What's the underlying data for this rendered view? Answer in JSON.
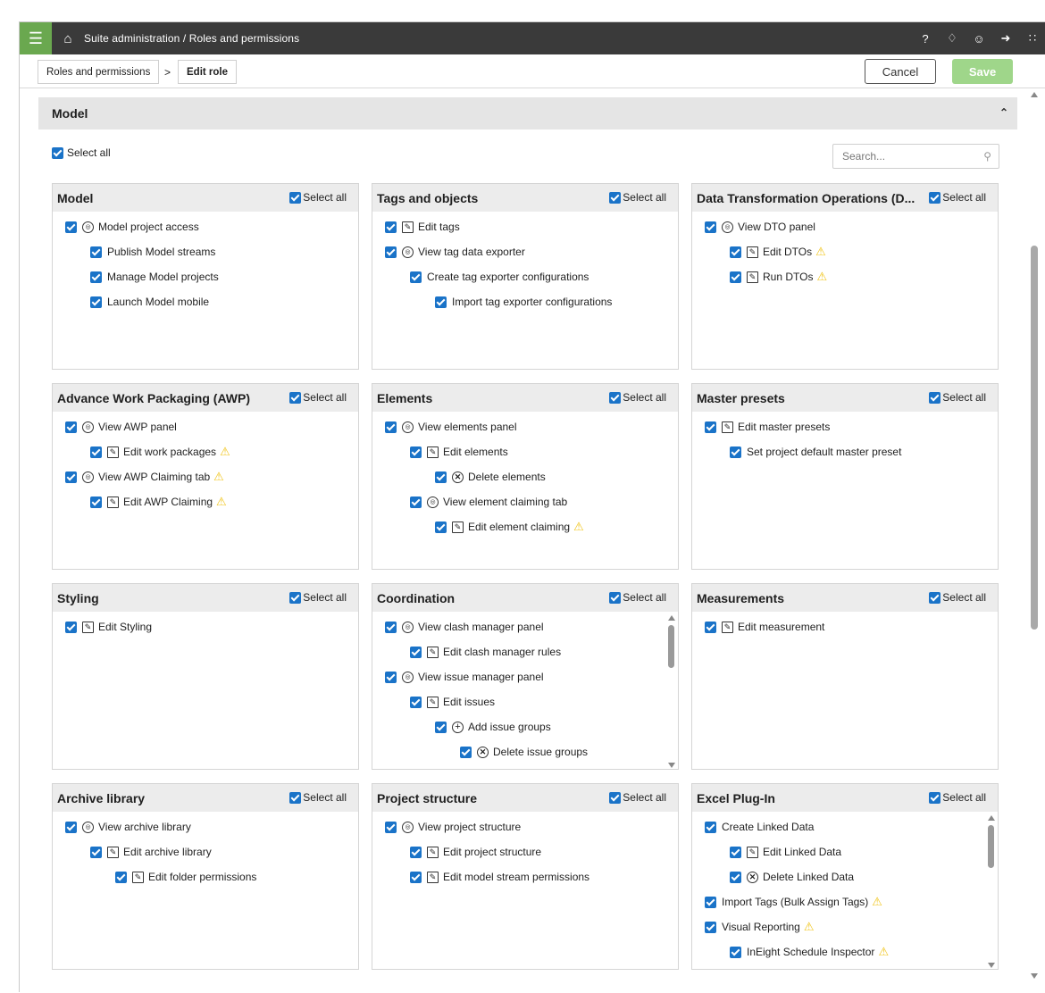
{
  "topbar": {
    "breadcrumb": "Suite administration  /  Roles and permissions",
    "icons": [
      "help-icon",
      "bell-icon",
      "user-icon",
      "logout-icon",
      "apps-grid-icon"
    ]
  },
  "subbar": {
    "crumb1": "Roles and permissions",
    "sep": ">",
    "crumb2": "Edit role",
    "cancel": "Cancel",
    "save": "Save"
  },
  "section": {
    "title": "Model",
    "select_all": "Select all",
    "search_placeholder": "Search..."
  },
  "colors": {
    "accent": "#6aa84f",
    "checkbox": "#1a73c8",
    "warning": "#f0c419"
  },
  "cards": [
    {
      "title": "Model",
      "select_all": "Select all",
      "items": [
        {
          "label": "Model project access",
          "icon": "view",
          "level": 0
        },
        {
          "label": "Publish Model streams",
          "icon": "",
          "level": 1
        },
        {
          "label": "Manage Model projects",
          "icon": "",
          "level": 1
        },
        {
          "label": "Launch Model mobile",
          "icon": "",
          "level": 1
        }
      ]
    },
    {
      "title": "Tags and objects",
      "select_all": "Select all",
      "items": [
        {
          "label": "Edit tags",
          "icon": "edit",
          "level": 0
        },
        {
          "label": "View tag data exporter",
          "icon": "view",
          "level": 0
        },
        {
          "label": "Create tag exporter configurations",
          "icon": "",
          "level": 1
        },
        {
          "label": "Import tag exporter configurations",
          "icon": "",
          "level": 2
        }
      ]
    },
    {
      "title": "Data Transformation Operations (D...",
      "select_all": "Select all",
      "items": [
        {
          "label": "View DTO panel",
          "icon": "view",
          "level": 0
        },
        {
          "label": "Edit DTOs",
          "icon": "edit",
          "level": 1,
          "warn": true
        },
        {
          "label": "Run DTOs",
          "icon": "edit",
          "level": 1,
          "warn": true
        }
      ]
    },
    {
      "title": "Advance Work Packaging (AWP)",
      "select_all": "Select all",
      "items": [
        {
          "label": "View AWP panel",
          "icon": "view",
          "level": 0
        },
        {
          "label": "Edit work packages",
          "icon": "edit",
          "level": 1,
          "warn": true
        },
        {
          "label": "View AWP Claiming tab",
          "icon": "view",
          "level": 0,
          "warn": true
        },
        {
          "label": "Edit AWP Claiming",
          "icon": "edit",
          "level": 1,
          "warn": true
        }
      ]
    },
    {
      "title": "Elements",
      "select_all": "Select all",
      "items": [
        {
          "label": "View elements panel",
          "icon": "view",
          "level": 0
        },
        {
          "label": "Edit elements",
          "icon": "edit",
          "level": 1
        },
        {
          "label": "Delete elements",
          "icon": "delete",
          "level": 2
        },
        {
          "label": "View element claiming tab",
          "icon": "view",
          "level": 1
        },
        {
          "label": "Edit element claiming",
          "icon": "edit",
          "level": 2,
          "warn": true
        }
      ]
    },
    {
      "title": "Master presets",
      "select_all": "Select all",
      "items": [
        {
          "label": "Edit master presets",
          "icon": "edit",
          "level": 0
        },
        {
          "label": "Set project default master preset",
          "icon": "",
          "level": 1
        }
      ]
    },
    {
      "title": "Styling",
      "select_all": "Select all",
      "items": [
        {
          "label": "Edit Styling",
          "icon": "edit",
          "level": 0
        }
      ]
    },
    {
      "title": "Coordination",
      "select_all": "Select all",
      "scroll": true,
      "items": [
        {
          "label": "View clash manager panel",
          "icon": "view",
          "level": 0
        },
        {
          "label": "Edit clash manager rules",
          "icon": "edit",
          "level": 1
        },
        {
          "label": "View issue manager panel",
          "icon": "view",
          "level": 0
        },
        {
          "label": "Edit issues",
          "icon": "edit",
          "level": 1
        },
        {
          "label": "Add issue groups",
          "icon": "add",
          "level": 2
        },
        {
          "label": "Delete issue groups",
          "icon": "delete",
          "level": 3
        }
      ]
    },
    {
      "title": "Measurements",
      "select_all": "Select all",
      "items": [
        {
          "label": "Edit measurement",
          "icon": "edit",
          "level": 0
        }
      ]
    },
    {
      "title": "Archive library",
      "select_all": "Select all",
      "items": [
        {
          "label": "View archive library",
          "icon": "view",
          "level": 0
        },
        {
          "label": "Edit archive library",
          "icon": "edit",
          "level": 1
        },
        {
          "label": "Edit folder permissions",
          "icon": "edit",
          "level": 2
        }
      ]
    },
    {
      "title": "Project structure",
      "select_all": "Select all",
      "items": [
        {
          "label": "View project structure",
          "icon": "view",
          "level": 0
        },
        {
          "label": "Edit project structure",
          "icon": "edit",
          "level": 1
        },
        {
          "label": "Edit model stream permissions",
          "icon": "edit",
          "level": 1
        }
      ]
    },
    {
      "title": "Excel Plug-In",
      "select_all": "Select all",
      "scroll": true,
      "items": [
        {
          "label": "Create Linked Data",
          "icon": "",
          "level": 0
        },
        {
          "label": "Edit Linked Data",
          "icon": "edit",
          "level": 1
        },
        {
          "label": "Delete Linked Data",
          "icon": "delete",
          "level": 1
        },
        {
          "label": "Import Tags (Bulk Assign Tags)",
          "icon": "",
          "level": 0,
          "warn": true
        },
        {
          "label": "Visual Reporting",
          "icon": "",
          "level": 0,
          "warn": true
        },
        {
          "label": "InEight Schedule Inspector",
          "icon": "",
          "level": 1,
          "warn": true
        }
      ]
    }
  ]
}
